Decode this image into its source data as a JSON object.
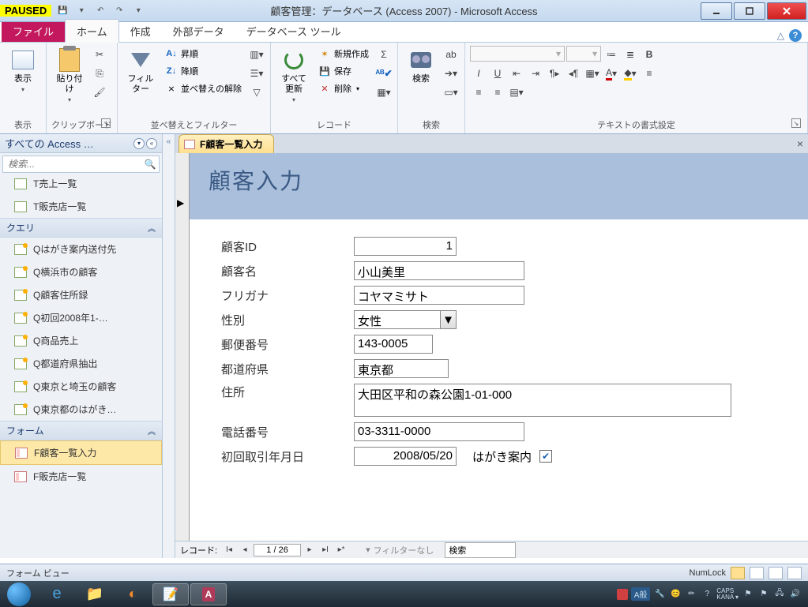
{
  "paused_badge": "PAUSED",
  "window_title": "顧客管理：データベース (Access 2007) - Microsoft Access",
  "ribbon_tabs": {
    "file": "ファイル",
    "home": "ホーム",
    "create": "作成",
    "external": "外部データ",
    "dbtools": "データベース ツール"
  },
  "ribbon": {
    "view": {
      "label": "表示",
      "group": "表示"
    },
    "clipboard": {
      "paste": "貼り付け",
      "group": "クリップボード"
    },
    "filter": {
      "label": "フィルター",
      "asc": "昇順",
      "desc": "降順",
      "clear": "並べ替えの解除",
      "group": "並べ替えとフィルター"
    },
    "records": {
      "refresh_line1": "すべて",
      "refresh_line2": "更新",
      "new": "新規作成",
      "save": "保存",
      "delete": "削除",
      "group": "レコード"
    },
    "find": {
      "label": "検索",
      "group": "検索"
    },
    "textfmt": {
      "group": "テキストの書式設定"
    }
  },
  "nav": {
    "header": "すべての Access …",
    "search_placeholder": "検索...",
    "tables": {
      "t1": "T売上一覧",
      "t2": "T販売店一覧"
    },
    "queries_hdr": "クエリ",
    "queries": {
      "q1": "Qはがき案内送付先",
      "q2": "Q横浜市の顧客",
      "q3": "Q顧客住所録",
      "q4": "Q初回2008年1-…",
      "q5": "Q商品売上",
      "q6": "Q都道府県抽出",
      "q7": "Q東京と埼玉の顧客",
      "q8": "Q東京都のはがき…"
    },
    "forms_hdr": "フォーム",
    "forms": {
      "f1": "F顧客一覧入力",
      "f2": "F販売店一覧"
    }
  },
  "form_tab": "F顧客一覧入力",
  "form_title": "顧客入力",
  "fields": {
    "id_label": "顧客ID",
    "id_value": "1",
    "name_label": "顧客名",
    "name_value": "小山美里",
    "kana_label": "フリガナ",
    "kana_value": "コヤマミサト",
    "sex_label": "性別",
    "sex_value": "女性",
    "zip_label": "郵便番号",
    "zip_value": "143-0005",
    "pref_label": "都道府県",
    "pref_value": "東京都",
    "addr_label": "住所",
    "addr_value": "大田区平和の森公園1-01-000",
    "tel_label": "電話番号",
    "tel_value": "03-3311-0000",
    "date_label": "初回取引年月日",
    "date_value": "2008/05/20",
    "postcard_label": "はがき案内"
  },
  "recnav": {
    "label": "レコード:",
    "pos": "1 / 26",
    "filter": "フィルターなし",
    "search": "検索"
  },
  "statusbar": {
    "left": "フォーム ビュー",
    "numlock": "NumLock"
  },
  "tray": {
    "lang": "A般",
    "caps": "CAPS",
    "kana": "KANA"
  }
}
